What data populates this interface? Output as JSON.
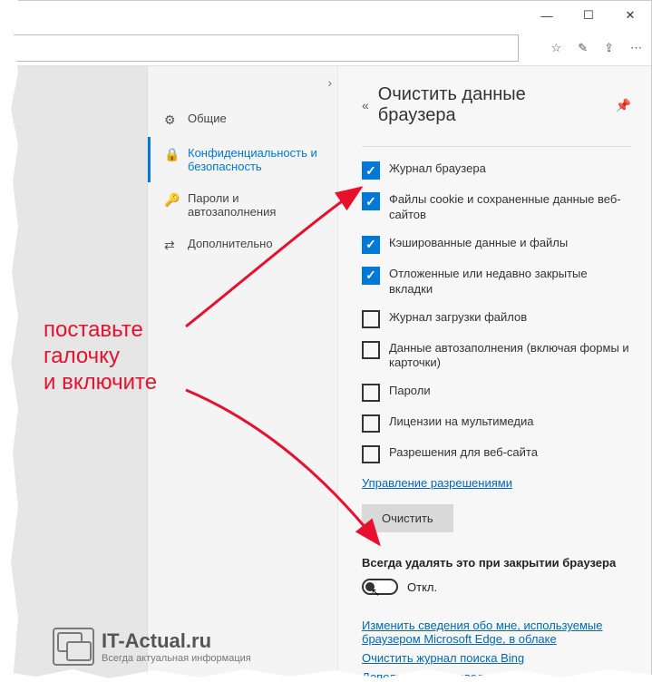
{
  "titlebar": {
    "minimize": "—",
    "maximize": "☐",
    "close": "✕"
  },
  "toolbar": {
    "star": "☆",
    "pen": "✎",
    "share": "⇪",
    "more": "⋯"
  },
  "sidebar": {
    "items": [
      {
        "icon": "⚙",
        "label": "Общие"
      },
      {
        "icon": "🔒",
        "label": "Конфиденциальность и безопасность"
      },
      {
        "icon": "🔑",
        "label": "Пароли и автозаполнения"
      },
      {
        "icon": "⇄",
        "label": "Дополнительно"
      }
    ],
    "active_index": 1
  },
  "panel": {
    "back": "«",
    "title": "Очистить данные браузера",
    "pin": "⊹",
    "checklist": [
      {
        "checked": true,
        "label": "Журнал браузера"
      },
      {
        "checked": true,
        "label": "Файлы cookie и сохраненные данные веб-сайтов"
      },
      {
        "checked": true,
        "label": "Кэшированные данные и файлы"
      },
      {
        "checked": true,
        "label": "Отложенные или недавно закрытые вкладки"
      },
      {
        "checked": false,
        "label": "Журнал загрузки файлов"
      },
      {
        "checked": false,
        "label": "Данные автозаполнения (включая формы и карточки)"
      },
      {
        "checked": false,
        "label": "Пароли"
      },
      {
        "checked": false,
        "label": "Лицензии на мультимедиа"
      },
      {
        "checked": false,
        "label": "Разрешения для веб-сайта"
      }
    ],
    "manage_permissions": "Управление разрешениями",
    "clear_button": "Очистить",
    "always_section": "Всегда удалять это при закрытии браузера",
    "toggle_state": "Откл.",
    "links": {
      "change_info": "Изменить сведения обо мне, используемые браузером Microsoft Edge, в облаке",
      "clear_bing": "Очистить журнал поиска Bing",
      "more_info": "Дополнительные сведения"
    }
  },
  "annotation": {
    "line1": "поставьте",
    "line2": "галочку",
    "line3": "и включите"
  },
  "watermark": {
    "title": "IT-Actual.ru",
    "subtitle": "Всегда актуальная информация"
  }
}
